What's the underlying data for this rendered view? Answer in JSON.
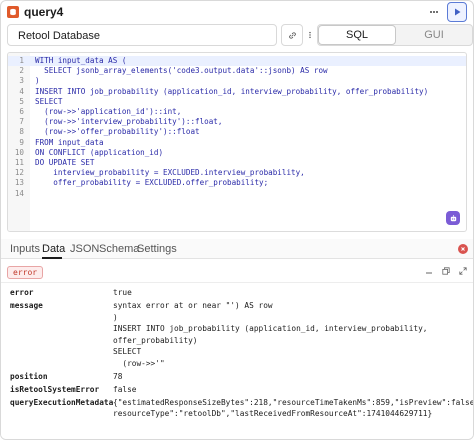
{
  "header": {
    "title": "query4"
  },
  "resource": {
    "name": "Retool Database",
    "modes": [
      "SQL",
      "GUI"
    ],
    "active_mode": "SQL"
  },
  "editor": {
    "lines": [
      {
        "n": "1",
        "fold": "",
        "code": "WITH input_data AS ("
      },
      {
        "n": "2",
        "fold": "",
        "code": "  SELECT jsonb_array_elements('code3.output.data'::jsonb) AS row"
      },
      {
        "n": "3",
        "fold": "",
        "code": ")"
      },
      {
        "n": "4",
        "fold": "",
        "code": "INSERT INTO job_probability (application_id, interview_probability, offer_probability)"
      },
      {
        "n": "5",
        "fold": "",
        "code": "SELECT"
      },
      {
        "n": "6",
        "fold": "",
        "code": "  (row->>'application_id')::int,"
      },
      {
        "n": "7",
        "fold": "",
        "code": "  (row->>'interview_probability')::float,"
      },
      {
        "n": "8",
        "fold": "",
        "code": "  (row->>'offer_probability')::float"
      },
      {
        "n": "9",
        "fold": "",
        "code": "FROM input_data"
      },
      {
        "n": "10",
        "fold": "",
        "code": "ON CONFLICT (application_id)"
      },
      {
        "n": "11",
        "fold": "",
        "code": "DO UPDATE SET"
      },
      {
        "n": "12",
        "fold": "",
        "code": "    interview_probability = EXCLUDED.interview_probability,"
      },
      {
        "n": "13",
        "fold": "",
        "code": "    offer_probability = EXCLUDED.offer_probability;"
      },
      {
        "n": "14",
        "fold": "",
        "code": ""
      }
    ]
  },
  "tabs": [
    "Inputs",
    "Data",
    "JSON",
    "Schema",
    "Settings"
  ],
  "active_tab": "Data",
  "results": {
    "chip": "error",
    "rows": [
      {
        "key": "error",
        "lines": [
          "true"
        ]
      },
      {
        "key": "message",
        "lines": [
          "syntax error at or near \"') AS row",
          ")",
          "INSERT INTO job_probability (application_id, interview_probability,",
          "offer_probability)",
          "SELECT",
          "  (row->>'\""
        ]
      },
      {
        "key": "position",
        "lines": [
          "78"
        ]
      },
      {
        "key": "isRetoolSystemError",
        "lines": [
          "false"
        ]
      },
      {
        "key": "queryExecutionMetadata",
        "lines": [
          "{\"estimatedResponseSizeBytes\":218,\"resourceTimeTakenMs\":859,\"isPreview\":false,\"",
          "resourceType\":\"retoolDb\",\"lastReceivedFromResourceAt\":1741044629711}"
        ]
      }
    ]
  },
  "colors": {
    "accent": "#5b7bd6",
    "error": "#c0392b",
    "brand_orange": "#e05a2b",
    "ai_purple": "#7b5cd6"
  },
  "icons": [
    "database-icon",
    "more-icon",
    "run-icon",
    "link-icon",
    "ai-assist-icon",
    "error-indicator-icon",
    "minimize-icon",
    "copy-icon",
    "expand-icon"
  ]
}
